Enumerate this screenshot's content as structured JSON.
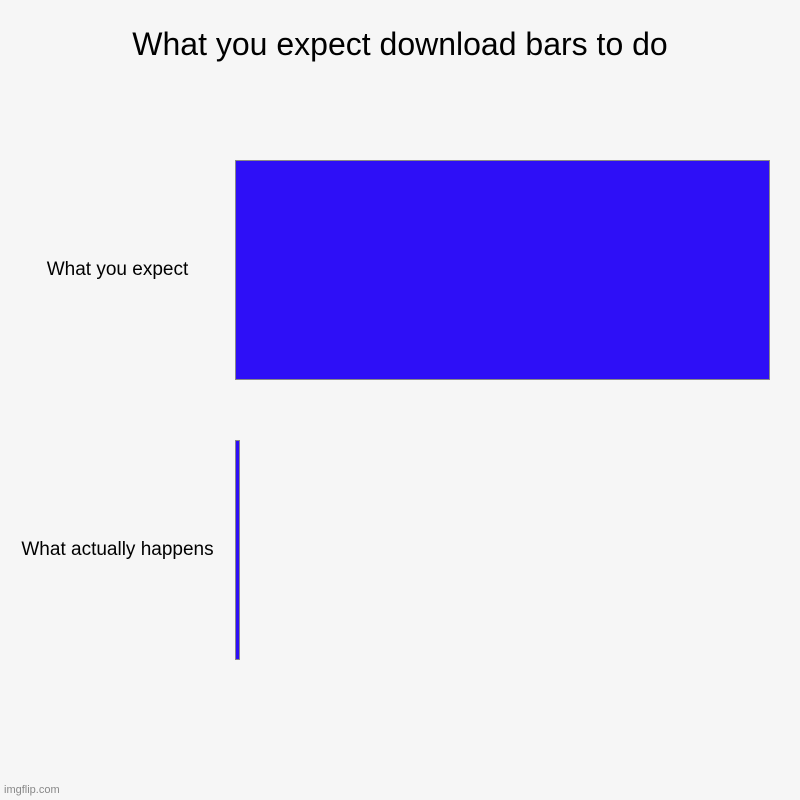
{
  "chart_data": {
    "type": "bar",
    "orientation": "horizontal",
    "title": "What you expect download bars to do",
    "categories": [
      "What you expect",
      "What actually happens"
    ],
    "values": [
      100,
      1
    ],
    "xlim": [
      0,
      100
    ],
    "bar_color": "#2e0ff7",
    "background": "#f6f6f6"
  },
  "watermark": "imgflip.com"
}
